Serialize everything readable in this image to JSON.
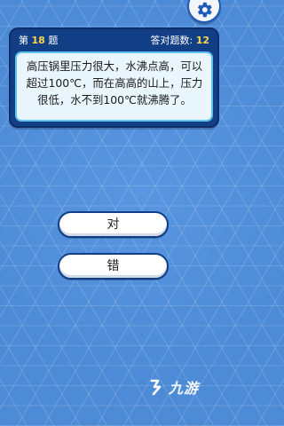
{
  "header": {
    "question_prefix": "第",
    "question_number": "18",
    "question_suffix": "题",
    "correct_label": "答对题数:",
    "correct_count": "12"
  },
  "question": {
    "text": "高压锅里压力很大，水沸点高，可以超过100℃，而在高高的山上，压力很低，水不到100℃就沸腾了。"
  },
  "answers": {
    "true_label": "对",
    "false_label": "错"
  },
  "icons": {
    "settings": "gear-icon",
    "watermark_logo": "logo-icon"
  },
  "watermark": {
    "text": "九游"
  },
  "colors": {
    "background": "#4f8fde",
    "card": "#123e86",
    "panel": "#e9f6fe",
    "panel_border": "#5cc2f0",
    "highlight_number": "#ffd84a",
    "button": "#ffffff"
  }
}
